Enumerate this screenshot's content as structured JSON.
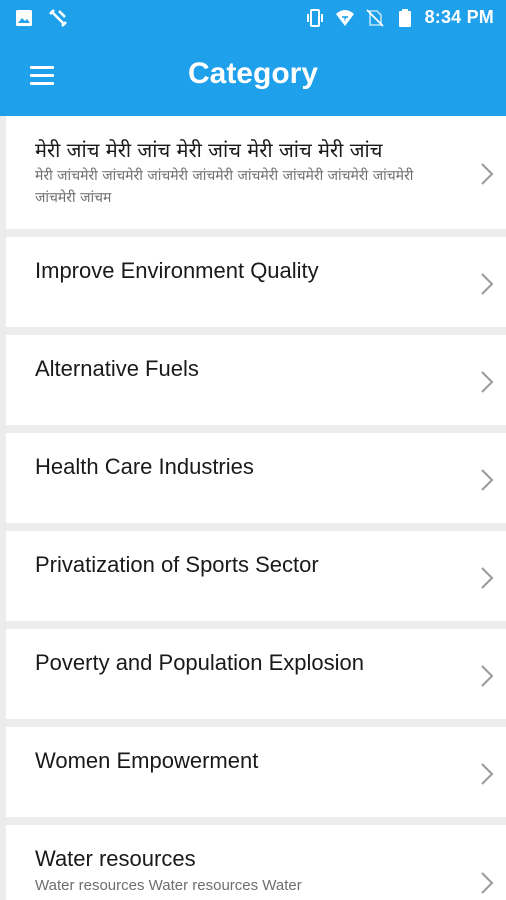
{
  "status_bar": {
    "time": "8:34 PM",
    "left_icons": [
      "image-icon",
      "fitness-icon"
    ],
    "right_icons": [
      "vibrate-icon",
      "wifi-icon",
      "no-sim-icon",
      "battery-icon"
    ]
  },
  "app_bar": {
    "title": "Category",
    "menu_icon": "hamburger-menu-icon"
  },
  "colors": {
    "accent": "#1ea0ea",
    "background": "#ececec",
    "card": "#ffffff"
  },
  "categories": [
    {
      "title": "मेरी जांच मेरी जांच मेरी जांच मेरी जांच मेरी जांच",
      "subtitle": "मेरी जांचमेरी जांचमेरी जांचमेरी जांचमेरी जांचमेरी जांचमेरी जांचमेरी जांचमेरी जांचमेरी जांचम"
    },
    {
      "title": "Improve Environment Quality",
      "subtitle": ""
    },
    {
      "title": "Alternative Fuels",
      "subtitle": ""
    },
    {
      "title": "Health Care Industries",
      "subtitle": ""
    },
    {
      "title": "Privatization of Sports Sector",
      "subtitle": ""
    },
    {
      "title": "Poverty and Population Explosion",
      "subtitle": ""
    },
    {
      "title": "Women Empowerment",
      "subtitle": ""
    },
    {
      "title": "Water resources",
      "subtitle": "Water resources Water resources Water"
    }
  ]
}
